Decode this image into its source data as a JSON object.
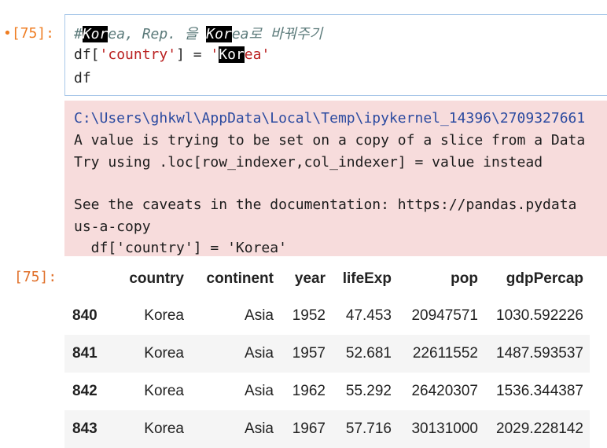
{
  "cell_in": {
    "prompt": "•[75]:",
    "code": {
      "comment_prefix": "#",
      "comment_hl1": "Kor",
      "comment_mid": "ea, Rep. 을 ",
      "comment_hl2": "Kor",
      "comment_end": "ea로 바꿔주기",
      "line2_a": "df[",
      "line2_str1": "'country'",
      "line2_b": "] = ",
      "line2_quote": "'",
      "line2_hl": "Kor",
      "line2_str2": "ea'",
      "line3": "df"
    }
  },
  "warning": {
    "path": "C:\\Users\\ghkwl\\AppData\\Local\\Temp\\ipykernel_14396\\2709327661",
    "line2": "A value is trying to be set on a copy of a slice from a Data",
    "line3": "Try using .loc[row_indexer,col_indexer] = value instead",
    "line4": "See the caveats in the documentation: https://pandas.pydata",
    "line5": "us-a-copy",
    "line6": "  df['country'] = 'Korea'"
  },
  "cell_out": {
    "prompt": "[75]:",
    "columns": [
      "",
      "country",
      "continent",
      "year",
      "lifeExp",
      "pop",
      "gdpPercap"
    ],
    "rows": [
      [
        "840",
        "Korea",
        "Asia",
        "1952",
        "47.453",
        "20947571",
        "1030.592226"
      ],
      [
        "841",
        "Korea",
        "Asia",
        "1957",
        "52.681",
        "22611552",
        "1487.593537"
      ],
      [
        "842",
        "Korea",
        "Asia",
        "1962",
        "55.292",
        "26420307",
        "1536.344387"
      ],
      [
        "843",
        "Korea",
        "Asia",
        "1967",
        "57.716",
        "30131000",
        "2029.228142"
      ]
    ]
  }
}
